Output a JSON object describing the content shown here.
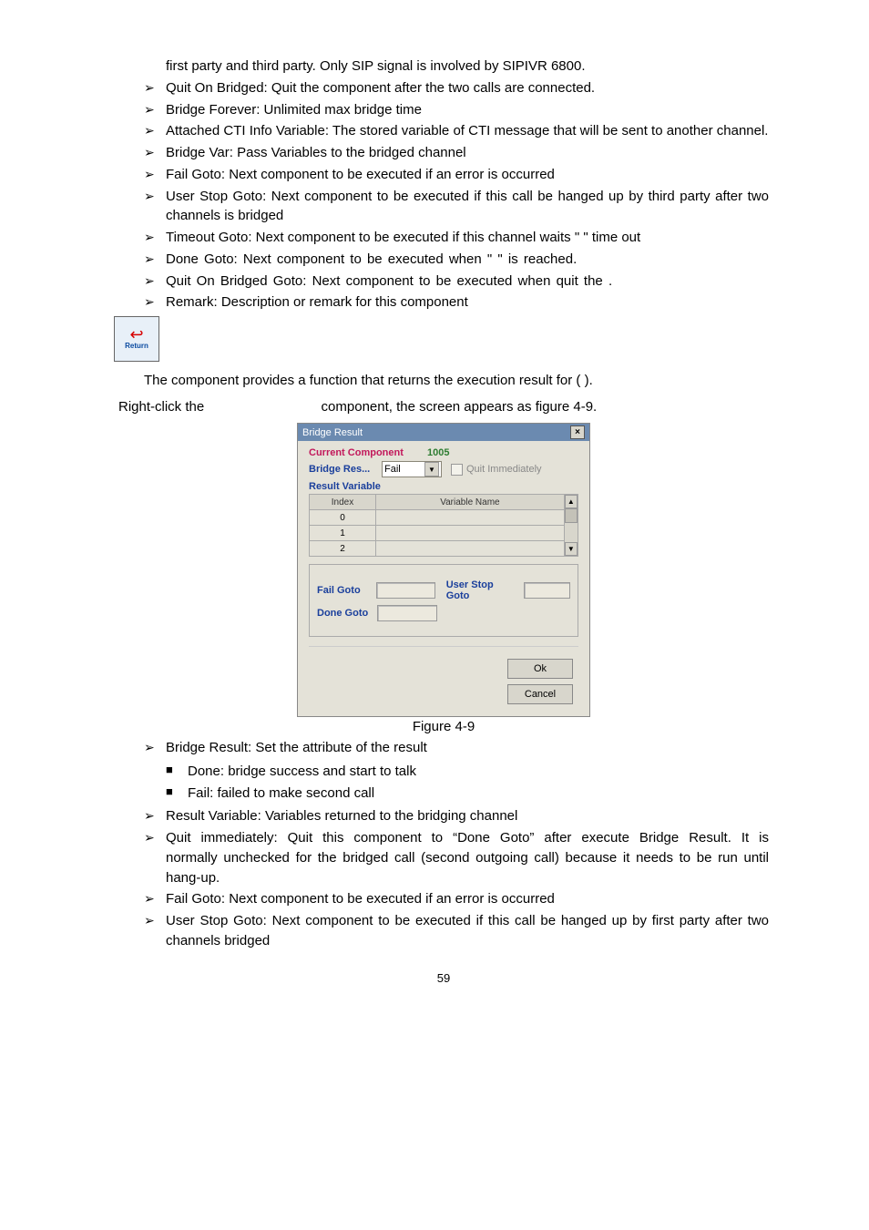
{
  "top_bullets": [
    "first party and third party. Only SIP signal is involved by SIPIVR 6800.",
    "Quit On Bridged: Quit the component after the two calls are connected.",
    "Bridge Forever: Unlimited max bridge time",
    "Attached CTI Info Variable: The stored variable of CTI message that will be sent to another channel.",
    "Bridge Var: Pass Variables to the bridged channel",
    "Fail Goto: Next component to be executed if an error is occurred",
    "User Stop Goto: Next component to be executed if this call be hanged up by third party after two channels is bridged",
    "Timeout Goto: Next component to be executed if this channel waits \"                             \" time out",
    "Done Goto: Next component to be executed when \"                                      \" is reached.",
    "Quit On Bridged Goto: Next component to be executed when quit the                 .",
    "Remark: Description or remark for this component"
  ],
  "icon_label": "Return",
  "para1": "The                              component provides a function that returns the execution result for                                  (                                                         ).",
  "para2_left": "Right-click the ",
  "para2_right": " component, the screen appears as figure 4-9.",
  "dialog": {
    "title": "Bridge Result",
    "current_component_lbl": "Current Component",
    "current_component_val": "1005",
    "bridge_res_lbl": "Bridge  Res...",
    "bridge_res_val": "Fail",
    "quit_lbl": "Quit Immediately",
    "result_var_lbl": "Result Variable",
    "col_index": "Index",
    "col_varname": "Variable Name",
    "rows": [
      "0",
      "1",
      "2"
    ],
    "fail_goto_lbl": "Fail Goto",
    "user_stop_lbl": "User Stop Goto",
    "done_goto_lbl": "Done Goto",
    "ok": "Ok",
    "cancel": "Cancel"
  },
  "caption": "Figure 4-9",
  "bottom_bullets": [
    "Bridge Result: Set the attribute of the result"
  ],
  "sub_bullets": [
    "Done: bridge success and start to talk",
    "Fail: failed to make second call"
  ],
  "bottom_bullets2": [
    "Result Variable: Variables returned to the bridging channel",
    "Quit immediately: Quit this component to “Done Goto” after execute Bridge Result. It is normally unchecked for the bridged call (second outgoing call) because it needs to be run until hang-up.",
    "Fail Goto: Next component to be executed if an error is occurred",
    "User Stop Goto: Next component to be executed if this call be hanged up by first party after two channels bridged"
  ],
  "page_number": "59"
}
